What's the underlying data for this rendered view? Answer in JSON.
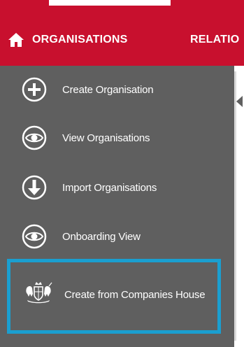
{
  "navbar": {
    "home_icon": "home-icon",
    "organisations_label": "ORGANISATIONS",
    "relationships_label": "RELATIO"
  },
  "sidebar": {
    "items": [
      {
        "label": "Create Organisation",
        "icon": "plus-circle-icon"
      },
      {
        "label": "View Organisations",
        "icon": "eye-icon"
      },
      {
        "label": "Import Organisations",
        "icon": "arrow-down-circle-icon"
      },
      {
        "label": "Onboarding View",
        "icon": "eye-icon"
      },
      {
        "label": "Create from Companies House",
        "icon": "royal-crest-icon",
        "highlighted": true
      }
    ]
  },
  "colors": {
    "brand": "#c8102e",
    "sidebar_bg": "#5f5f5f",
    "highlight": "#1a9fd0"
  }
}
